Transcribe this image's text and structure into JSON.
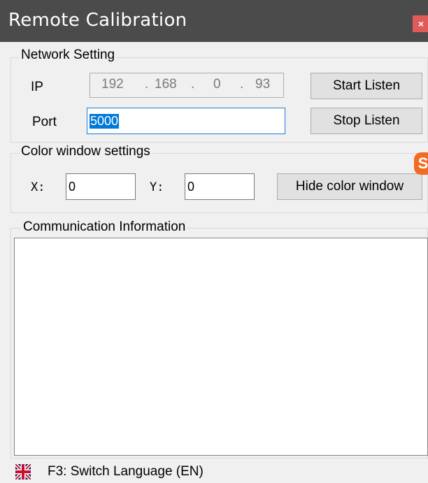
{
  "window": {
    "title": "Remote Calibration",
    "close_label": "×"
  },
  "network": {
    "group_label": "Network Setting",
    "ip_label": "IP",
    "ip_octets": [
      "192",
      "168",
      "0",
      "93"
    ],
    "ip_dot": ".",
    "port_label": "Port",
    "port_value": "5000",
    "start_button": "Start Listen",
    "stop_button": "Stop Listen"
  },
  "color_window": {
    "group_label": "Color window settings",
    "x_label": "X:",
    "x_value": "0",
    "y_label": "Y:",
    "y_value": "0",
    "hide_button": "Hide color window"
  },
  "communication": {
    "group_label": "Communication Information",
    "log_text": ""
  },
  "status_bar": {
    "text": "F3: Switch Language (EN)",
    "flag_icon": "uk-flag-icon"
  },
  "overlay": {
    "badge_letter": "S",
    "badge_color": "#f26b22"
  },
  "colors": {
    "titlebar": "#4b4b4b",
    "close": "#e05a5a",
    "selection": "#0078d7"
  }
}
